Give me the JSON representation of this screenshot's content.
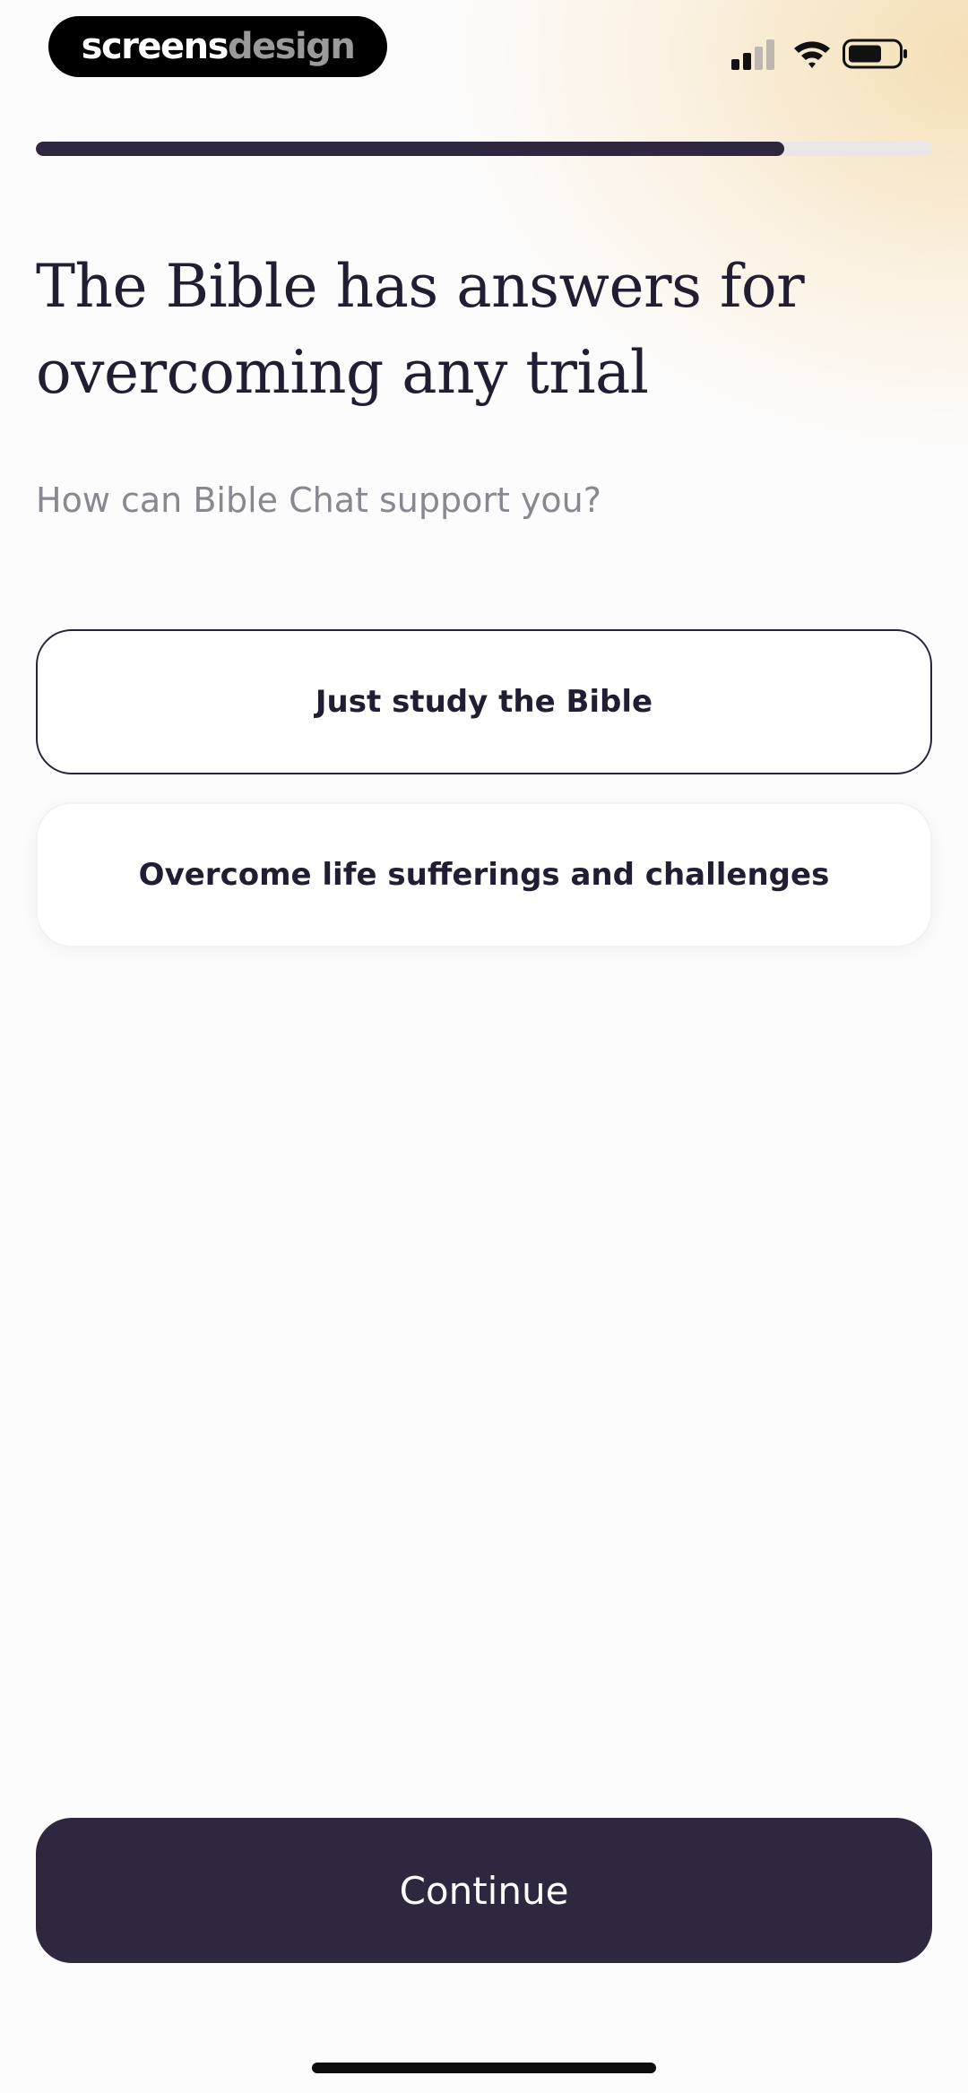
{
  "status_bar": {
    "brand_primary": "screens",
    "brand_secondary": "design",
    "signal_icon": "cellular-signal-icon",
    "wifi_icon": "wifi-icon",
    "battery_icon": "battery-icon"
  },
  "progress": {
    "fraction": 0.835
  },
  "main": {
    "title": "The Bible has answers for overcoming any trial",
    "subtitle": "How can Bible Chat support you?",
    "options": [
      {
        "label": "Just study the Bible",
        "selected": true
      },
      {
        "label": "Overcome life sufferings and challenges",
        "selected": false
      }
    ]
  },
  "footer": {
    "continue_label": "Continue"
  },
  "colors": {
    "accent": "#2f2640",
    "text": "#231d33",
    "muted": "#8a8790",
    "glow": "#f4deb2"
  }
}
